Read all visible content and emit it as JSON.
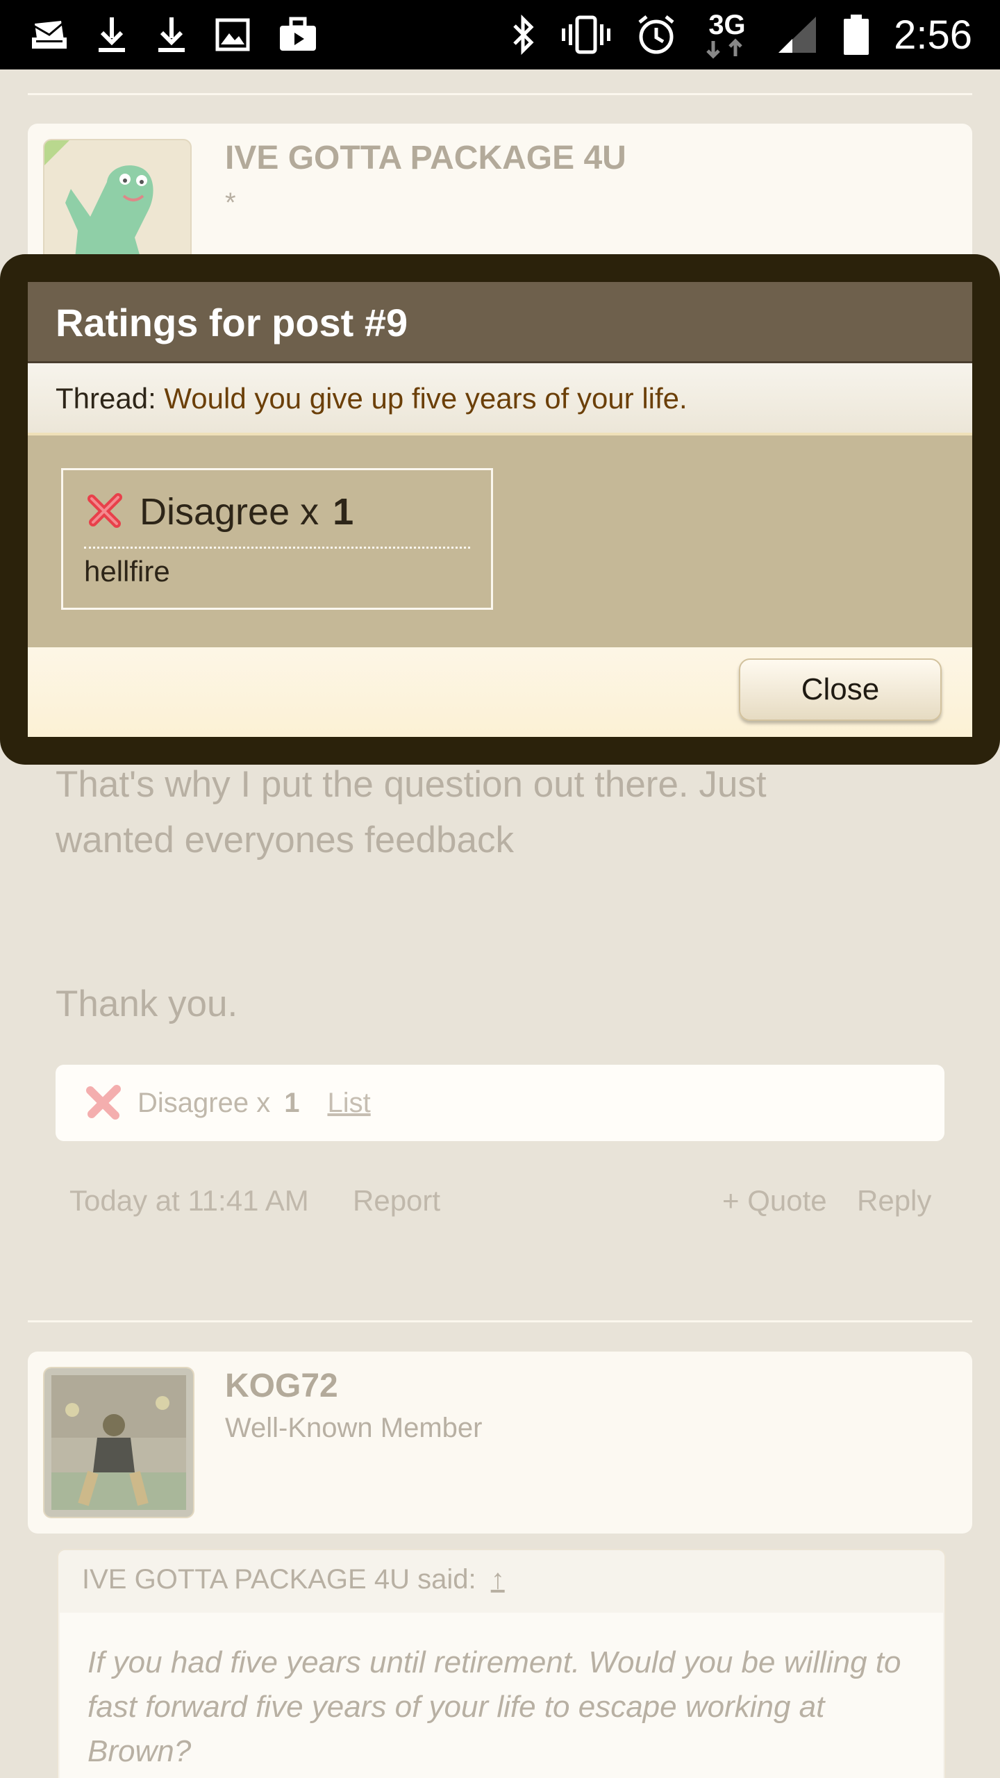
{
  "status_bar": {
    "time": "2:56",
    "network": "3G",
    "left_icons": [
      "mail-icon",
      "download-icon",
      "download-icon",
      "image-icon",
      "briefcase-icon"
    ],
    "right_icons": [
      "bluetooth-icon",
      "vibrate-icon",
      "alarm-icon",
      "network-3g-icon",
      "signal-icon",
      "battery-icon"
    ]
  },
  "post1": {
    "username": "IVE GOTTA PACKAGE 4U",
    "user_title": "*",
    "body_lines": [
      "That's why I put the question out there. Just",
      "wanted everyones feedback"
    ],
    "thanks": "Thank you.",
    "rating": {
      "label": "Disagree x",
      "count": "1",
      "list_link": "List"
    },
    "timestamp": "Today at 11:41 AM",
    "report": "Report",
    "quote": "+ Quote",
    "reply": "Reply"
  },
  "post2": {
    "username": "KOG72",
    "user_title": "Well-Known Member",
    "quote_head": "IVE GOTTA PACKAGE 4U said:",
    "quote_arrow": "↑",
    "quote_text": "If you had five years until retirement. Would you be willing to fast forward five years of your life to escape working at Brown?"
  },
  "modal": {
    "title": "Ratings for post #9",
    "thread_label": "Thread:",
    "thread_title": "Would you give up five years of your life.",
    "rating_name": "Disagree x",
    "rating_count": "1",
    "rater": "hellfire",
    "close_label": "Close"
  },
  "colors": {
    "overlay_frame": "#2b220b",
    "modal_title_bar": "#6e604c",
    "modal_body": "#c5b897",
    "thread_link": "#6b3f08",
    "page_background": "#e8e3d8"
  }
}
